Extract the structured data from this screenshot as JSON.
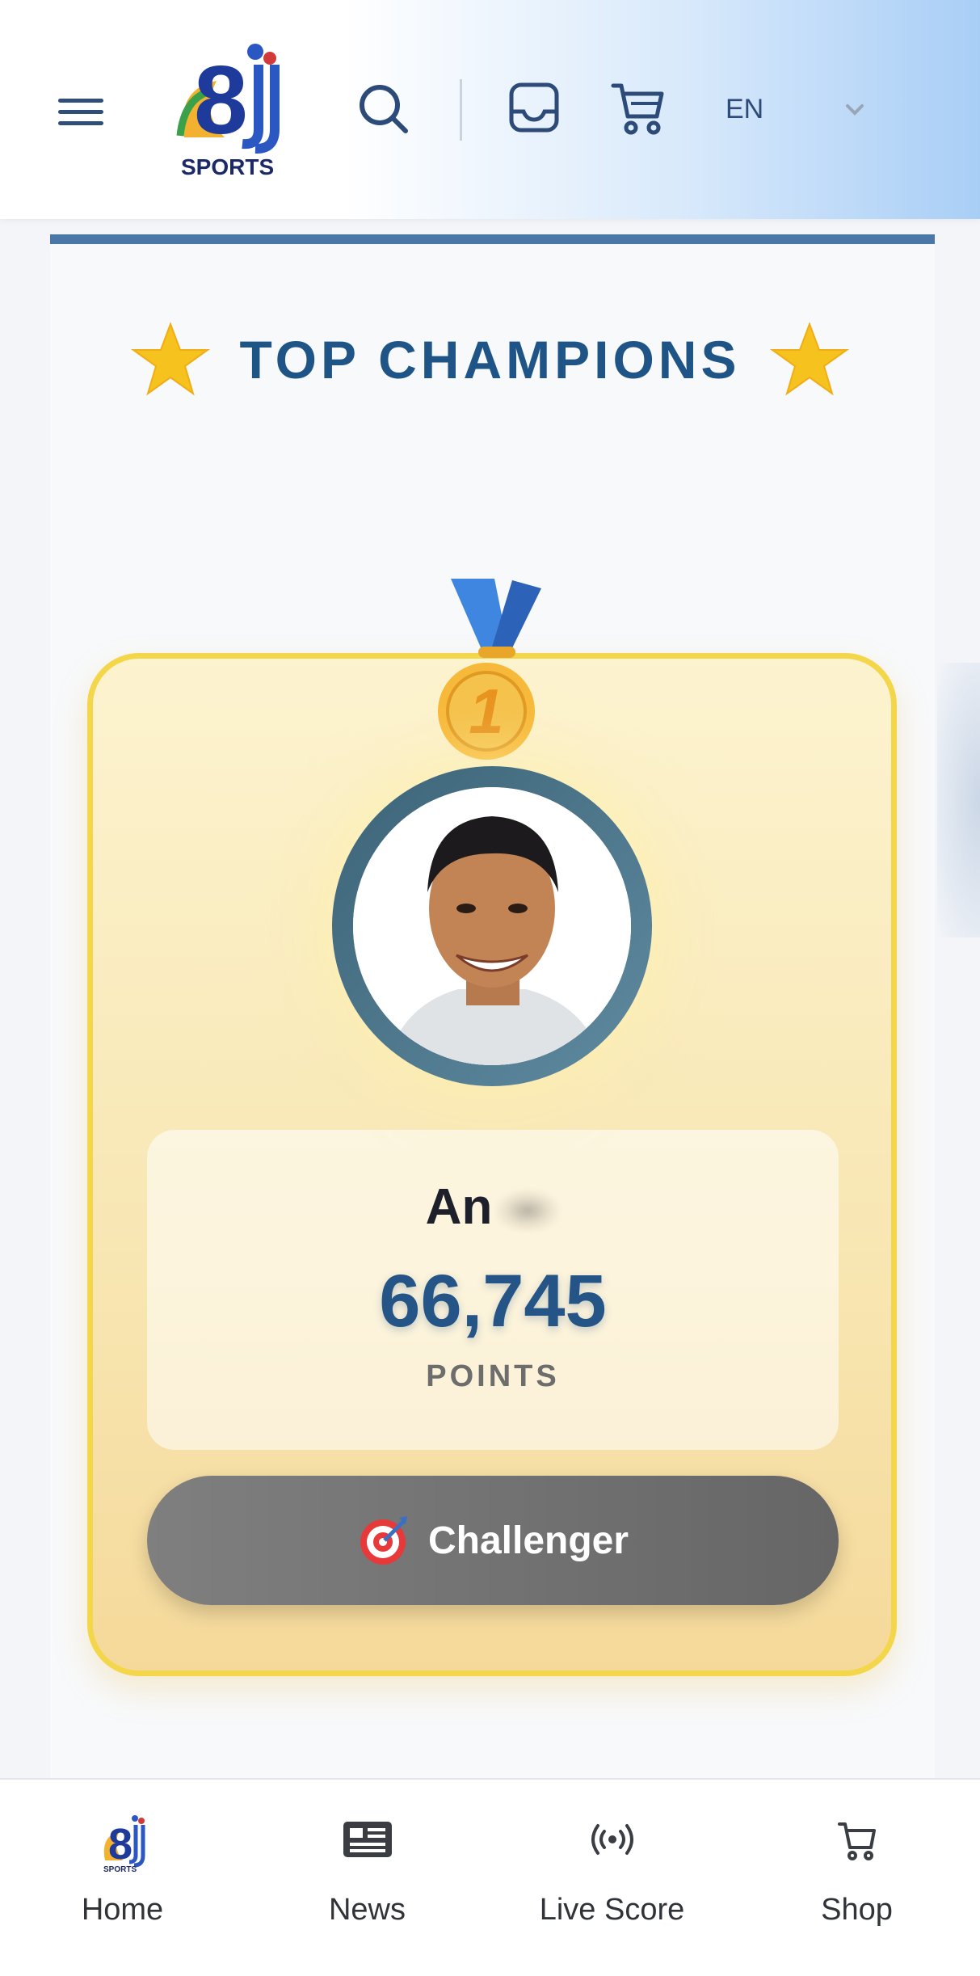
{
  "header": {
    "logo_text": "SPORTS",
    "logo_digits": "8",
    "language": "EN"
  },
  "section": {
    "title": "TOP CHAMPIONS"
  },
  "champion": {
    "rank": "1",
    "name": "An",
    "points": "66,745",
    "points_label": "POINTS",
    "badge": "Challenger"
  },
  "bottom_nav": {
    "items": [
      {
        "label": "Home",
        "icon": "logo-icon"
      },
      {
        "label": "News",
        "icon": "newspaper-icon"
      },
      {
        "label": "Live Score",
        "icon": "broadcast-icon"
      },
      {
        "label": "Shop",
        "icon": "cart-icon"
      }
    ]
  },
  "colors": {
    "accent": "#1f5487",
    "card_border": "#f4d64a",
    "header_gradient_end": "#a9cef6"
  }
}
